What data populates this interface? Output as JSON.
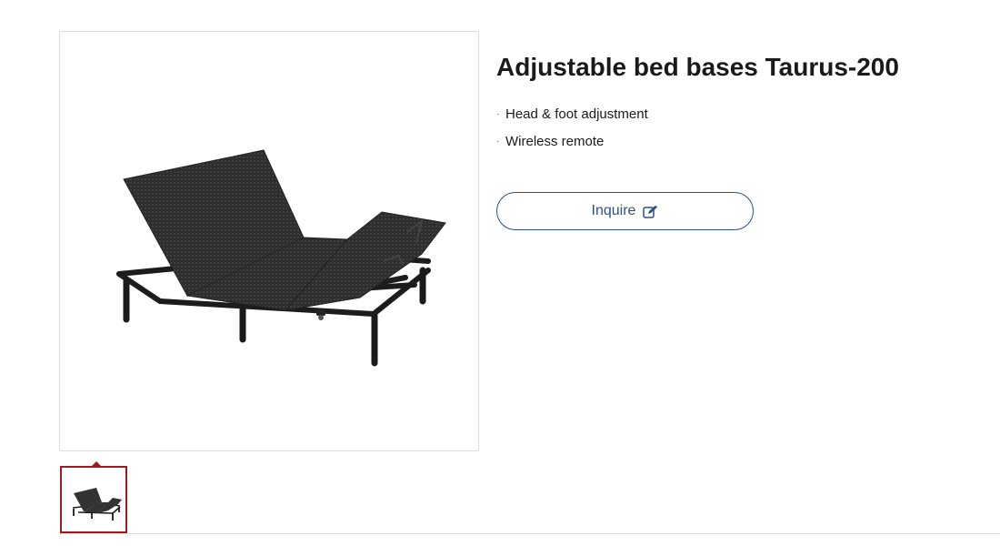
{
  "product": {
    "title": "Adjustable bed bases Taurus-200",
    "features": [
      {
        "bullet": "·",
        "text": "Head & foot adjustment"
      },
      {
        "bullet": "·",
        "text": "Wireless remote"
      }
    ],
    "image_alt": "adjustable-bed-base",
    "thumbnails": [
      {
        "selected": true,
        "icon": "bed-thumbnail"
      }
    ]
  },
  "actions": {
    "inquire_label": "Inquire",
    "inquire_icon": "edit-icon"
  },
  "colors": {
    "accent": "#2c5282",
    "thumb_selected_border": "#9b1c1c",
    "divider": "#dddddd",
    "text": "#1a1a1a"
  }
}
